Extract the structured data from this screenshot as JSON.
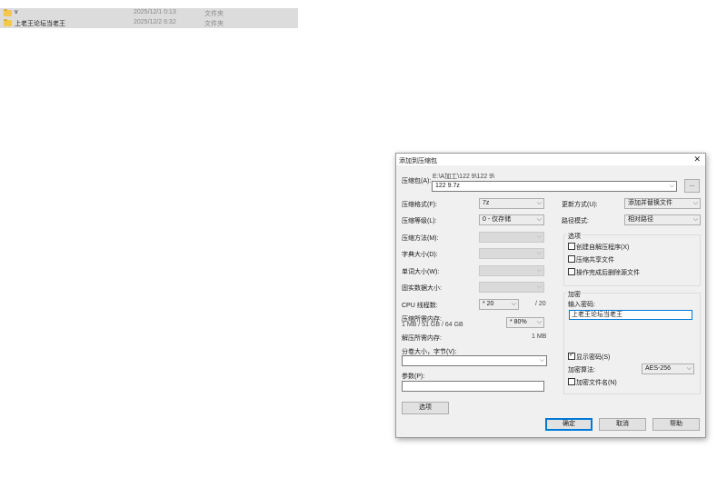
{
  "explorer": {
    "rows": [
      {
        "name": "v",
        "date": "2025/12/1 0:13",
        "type": "文件夹"
      },
      {
        "name": "上老王论坛当老王",
        "date": "2025/12/2 6:32",
        "type": "文件夹"
      }
    ]
  },
  "dialog": {
    "title": "添加到压缩包",
    "archive_label": "压缩包(A):",
    "archive_path": "E:\\A加工\\122 9\\122 9\\",
    "archive_name": "122 9.7z",
    "browse_label": "...",
    "format_label": "压缩格式(F):",
    "format_value": "7z",
    "level_label": "压缩等级(L):",
    "level_value": "0 - 仅存储",
    "method_label": "压缩方法(M):",
    "dict_label": "字典大小(D):",
    "word_label": "单词大小(W):",
    "solid_label": "固实数据大小:",
    "threads_label": "CPU 线程数:",
    "threads_value": "* 20",
    "threads_max": "/ 20",
    "mem_label": "压缩所需内存:",
    "mem_value": "1 MB / 51 GB / 64 GB",
    "mem_pct": "* 80%",
    "unmem_label": "解压所需内存:",
    "unmem_value": "1 MB",
    "split_label": "分卷大小，字节(V):",
    "split_value": "",
    "params_label": "参数(P):",
    "params_value": "",
    "options_button": "选项",
    "update_label": "更新方式(U):",
    "update_value": "添加并替换文件",
    "path_label": "路径模式:",
    "path_value": "相对路径",
    "options_group": "选项",
    "opt_sfx": "创建自解压程序(X)",
    "opt_shared": "压缩共享文件",
    "opt_delete": "操作完成后删除源文件",
    "encrypt_group": "加密",
    "password_label": "输入密码:",
    "password_value": "上老王论坛当老王",
    "show_password": "显示密码(S)",
    "enc_method_label": "加密算法:",
    "enc_method_value": "AES-256",
    "enc_names": "加密文件名(N)",
    "ok": "确定",
    "cancel": "取消",
    "help": "帮助"
  }
}
